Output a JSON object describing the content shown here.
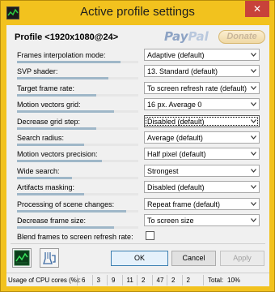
{
  "window": {
    "title": "Active profile settings",
    "close_glyph": "✕",
    "app_icon": "graph-icon"
  },
  "profile": {
    "label": "Profile <1920x1080@24>"
  },
  "paypal": {
    "pay": "Pay",
    "pal": "Pal",
    "donate_label": "Donate"
  },
  "settings": [
    {
      "label": "Frames interpolation mode:",
      "value": "Adaptive (default)",
      "type": "select"
    },
    {
      "label": "SVP shader:",
      "value": "13. Standard (default)",
      "type": "select"
    },
    {
      "label": "Target frame rate:",
      "value": "To screen refresh rate (default)",
      "type": "select"
    },
    {
      "label": "Motion vectors grid:",
      "value": "16 px. Average 0",
      "type": "select"
    },
    {
      "label": "Decrease grid step:",
      "value": "Disabled (default)",
      "type": "select"
    },
    {
      "label": "Search radius:",
      "value": "Average (default)",
      "type": "select"
    },
    {
      "label": "Motion vectors precision:",
      "value": "Half pixel (default)",
      "type": "select"
    },
    {
      "label": "Wide search:",
      "value": "Strongest",
      "type": "select"
    },
    {
      "label": "Artifacts masking:",
      "value": "Disabled (default)",
      "type": "select"
    },
    {
      "label": "Processing of scene changes:",
      "value": "Repeat frame (default)",
      "type": "select"
    },
    {
      "label": "Decrease frame size:",
      "value": "To screen size",
      "type": "select"
    },
    {
      "label": "Blend frames to screen refresh rate:",
      "value": "",
      "type": "checkbox",
      "checked": false
    }
  ],
  "setting_bar_levels": [
    0.85,
    0.75,
    0.65,
    0.8,
    0.65,
    0.55,
    0.7,
    0.45,
    0.55,
    0.9,
    0.8,
    0.0
  ],
  "buttons": {
    "ok": "OK",
    "cancel": "Cancel",
    "apply": "Apply"
  },
  "tools": {
    "graph": "graph-icon",
    "cleanup": "broom-icon"
  },
  "status": {
    "cpu_label": "Usage of CPU cores (%):",
    "cpu_values": [
      "6",
      "3",
      "9",
      "11",
      "2",
      "47",
      "2",
      "2"
    ],
    "total_label": "Total:",
    "total_value": "10%"
  },
  "colors": {
    "title_bg": "#f2c21e",
    "close_bg": "#c8423a",
    "bar_fill": "#9fb7c8"
  }
}
